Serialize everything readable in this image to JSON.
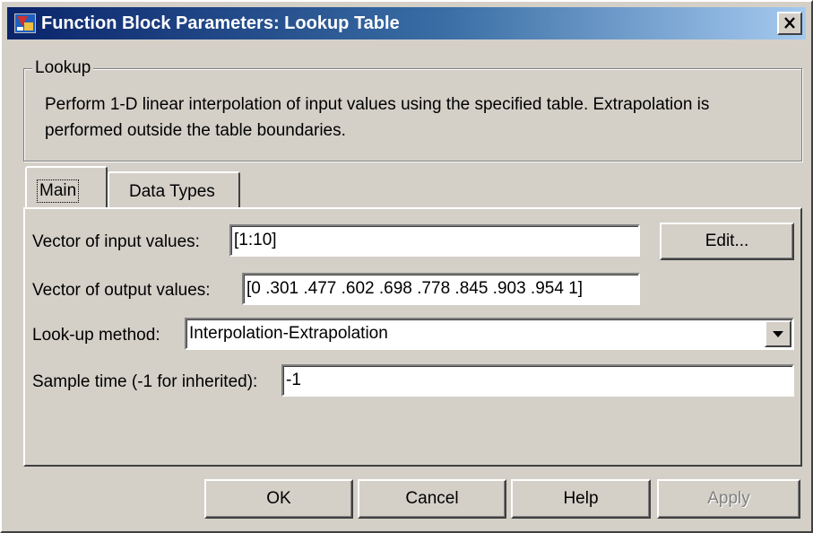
{
  "window": {
    "title": "Function Block Parameters: Lookup Table",
    "close_glyph": "×"
  },
  "group": {
    "legend": "Lookup",
    "description": "Perform 1-D linear interpolation of input values using the specified table.  Extrapolation is performed outside the table boundaries."
  },
  "tabs": [
    {
      "label": "Main",
      "active": true
    },
    {
      "label": "Data Types",
      "active": false
    }
  ],
  "params": {
    "input_values": {
      "label": "Vector of input values:",
      "value": "[1:10]"
    },
    "edit_button": "Edit...",
    "output_values": {
      "label": "Vector of output values:",
      "value": "[0 .301 .477 .602 .698 .778 .845 .903 .954 1]"
    },
    "lookup_method": {
      "label": "Look-up method:",
      "value": "Interpolation-Extrapolation"
    },
    "sample_time": {
      "label": "Sample time (-1 for inherited):",
      "value": "-1"
    }
  },
  "buttons": {
    "ok": "OK",
    "cancel": "Cancel",
    "help": "Help",
    "apply": "Apply"
  },
  "colors": {
    "title_gradient_start": "#0a246a",
    "title_gradient_end": "#a6caf0",
    "face": "#d4d0c8"
  },
  "icons": {
    "app": "simulink-block-icon",
    "close": "close-icon",
    "dropdown": "chevron-down-icon"
  }
}
